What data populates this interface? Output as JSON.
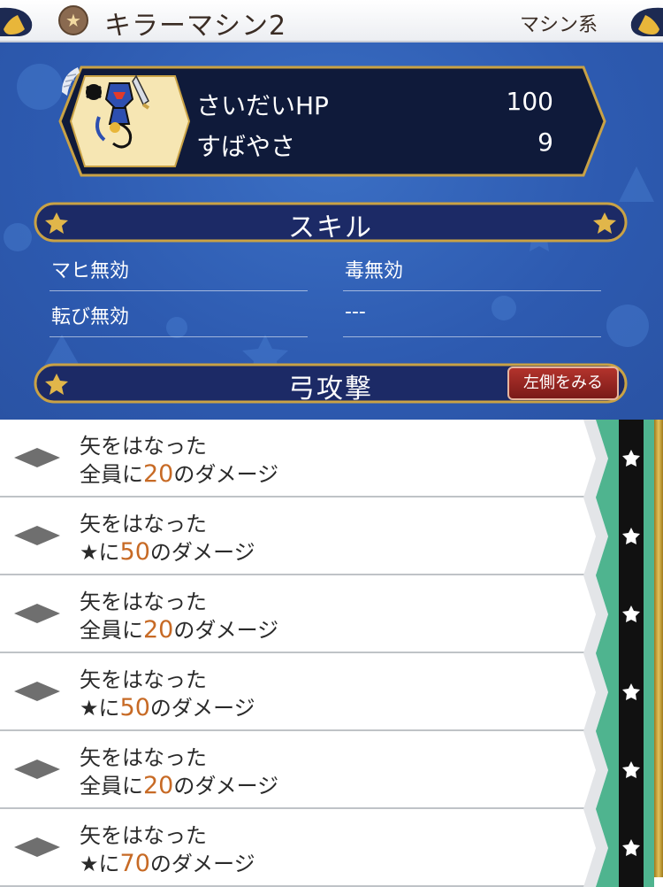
{
  "header": {
    "title": "キラーマシン2",
    "category": "マシン系",
    "badge_icon": "star-icon"
  },
  "stats": {
    "hp_label": "さいだいHP",
    "hp_value": "100",
    "speed_label": "すばやさ",
    "speed_value": "9",
    "speed_icon": "wing-icon"
  },
  "skills": {
    "title": "スキル",
    "items": [
      "マヒ無効",
      "毒無効",
      "転び無効",
      "---"
    ]
  },
  "attack": {
    "title": "弓攻撃",
    "left_button": "左側をみる",
    "rows": [
      {
        "action": "矢をはなった",
        "target": "全員に",
        "amount": "20",
        "suffix": "のダメージ"
      },
      {
        "action": "矢をはなった",
        "target": "★に",
        "amount": "50",
        "suffix": "のダメージ"
      },
      {
        "action": "矢をはなった",
        "target": "全員に",
        "amount": "20",
        "suffix": "のダメージ"
      },
      {
        "action": "矢をはなった",
        "target": "★に",
        "amount": "50",
        "suffix": "のダメージ"
      },
      {
        "action": "矢をはなった",
        "target": "全員に",
        "amount": "20",
        "suffix": "のダメージ"
      },
      {
        "action": "矢をはなった",
        "target": "★に",
        "amount": "70",
        "suffix": "のダメージ"
      }
    ]
  },
  "colors": {
    "panel_blue": "#2d5ab0",
    "banner_navy": "#1c2a66",
    "gold_border": "#c9a245",
    "damage_number": "#c76a25",
    "tab_green": "#4fb48f"
  }
}
